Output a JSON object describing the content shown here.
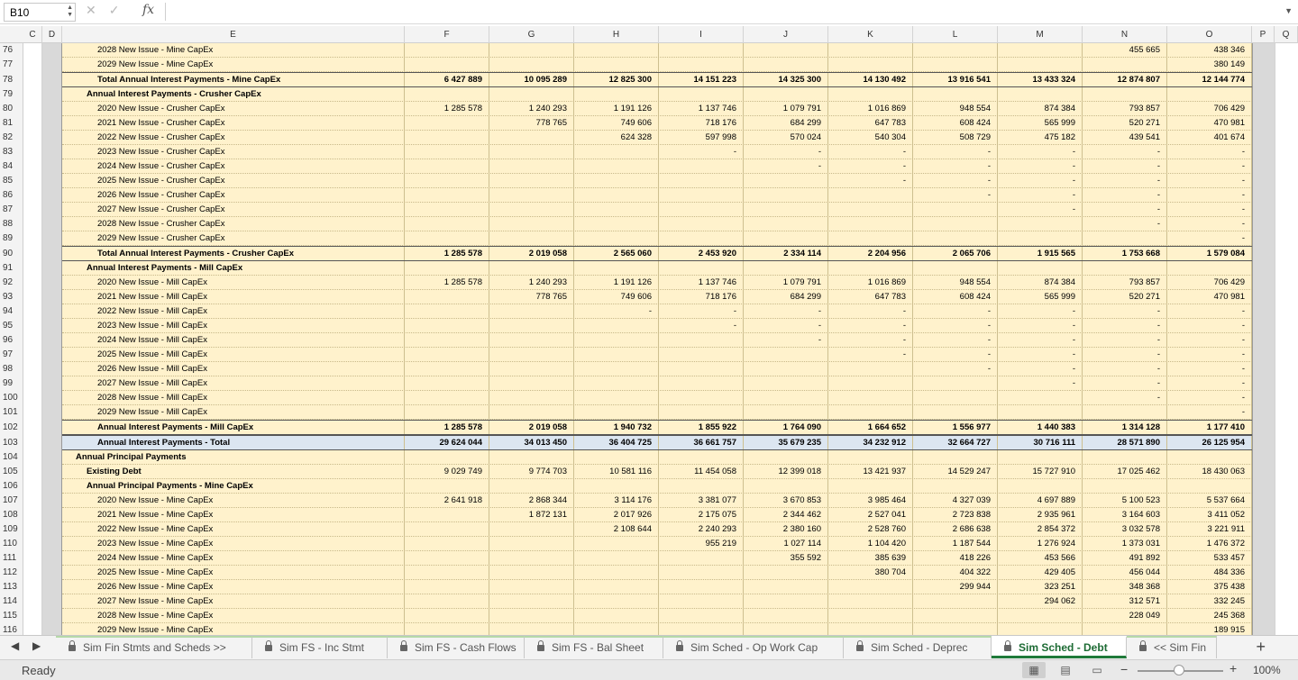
{
  "formula_bar": {
    "name_box": "B10",
    "fx_label": "fx"
  },
  "columns": {
    "narrow": [
      "C",
      "D"
    ],
    "wide": [
      "E",
      "F",
      "G",
      "H",
      "I",
      "J",
      "K",
      "L",
      "M",
      "N",
      "O"
    ],
    "right": [
      "P",
      "Q"
    ]
  },
  "rows": [
    {
      "n": "76",
      "label": "2028 New Issue - Mine CapEx",
      "lvl": 2,
      "type": "item",
      "v": [
        "",
        "",
        "",
        "",
        "",
        "",
        "",
        "",
        "455 665",
        "438 346"
      ]
    },
    {
      "n": "77",
      "label": "2029 New Issue - Mine CapEx",
      "lvl": 2,
      "type": "item",
      "v": [
        "",
        "",
        "",
        "",
        "",
        "",
        "",
        "",
        "",
        "380 149"
      ]
    },
    {
      "n": "78",
      "label": "Total Annual Interest Payments - Mine CapEx",
      "lvl": 2,
      "type": "total",
      "v": [
        "6 427 889",
        "10 095 289",
        "12 825 300",
        "14 151 223",
        "14 325 300",
        "14 130 492",
        "13 916 541",
        "13 433 324",
        "12 874 807",
        "12 144 774"
      ]
    },
    {
      "n": "79",
      "label": "Annual Interest Payments - Crusher CapEx",
      "lvl": 1,
      "type": "header",
      "v": [
        "",
        "",
        "",
        "",
        "",
        "",
        "",
        "",
        "",
        ""
      ]
    },
    {
      "n": "80",
      "label": "2020 New Issue - Crusher CapEx",
      "lvl": 2,
      "type": "item",
      "v": [
        "1 285 578",
        "1 240 293",
        "1 191 126",
        "1 137 746",
        "1 079 791",
        "1 016 869",
        "948 554",
        "874 384",
        "793 857",
        "706 429"
      ]
    },
    {
      "n": "81",
      "label": "2021 New Issue - Crusher CapEx",
      "lvl": 2,
      "type": "item",
      "v": [
        "",
        "778 765",
        "749 606",
        "718 176",
        "684 299",
        "647 783",
        "608 424",
        "565 999",
        "520 271",
        "470 981"
      ]
    },
    {
      "n": "82",
      "label": "2022 New Issue - Crusher CapEx",
      "lvl": 2,
      "type": "item",
      "v": [
        "",
        "",
        "624 328",
        "597 998",
        "570 024",
        "540 304",
        "508 729",
        "475 182",
        "439 541",
        "401 674"
      ]
    },
    {
      "n": "83",
      "label": "2023 New Issue - Crusher CapEx",
      "lvl": 2,
      "type": "item",
      "v": [
        "",
        "",
        "",
        "-",
        "-",
        "-",
        "-",
        "-",
        "-",
        "-"
      ]
    },
    {
      "n": "84",
      "label": "2024 New Issue - Crusher CapEx",
      "lvl": 2,
      "type": "item",
      "v": [
        "",
        "",
        "",
        "",
        "-",
        "-",
        "-",
        "-",
        "-",
        "-"
      ]
    },
    {
      "n": "85",
      "label": "2025 New Issue - Crusher CapEx",
      "lvl": 2,
      "type": "item",
      "v": [
        "",
        "",
        "",
        "",
        "",
        "-",
        "-",
        "-",
        "-",
        "-"
      ]
    },
    {
      "n": "86",
      "label": "2026 New Issue - Crusher CapEx",
      "lvl": 2,
      "type": "item",
      "v": [
        "",
        "",
        "",
        "",
        "",
        "",
        "-",
        "-",
        "-",
        "-"
      ]
    },
    {
      "n": "87",
      "label": "2027 New Issue - Crusher CapEx",
      "lvl": 2,
      "type": "item",
      "v": [
        "",
        "",
        "",
        "",
        "",
        "",
        "",
        "-",
        "-",
        "-"
      ]
    },
    {
      "n": "88",
      "label": "2028 New Issue - Crusher CapEx",
      "lvl": 2,
      "type": "item",
      "v": [
        "",
        "",
        "",
        "",
        "",
        "",
        "",
        "",
        "-",
        "-"
      ]
    },
    {
      "n": "89",
      "label": "2029 New Issue - Crusher CapEx",
      "lvl": 2,
      "type": "item",
      "v": [
        "",
        "",
        "",
        "",
        "",
        "",
        "",
        "",
        "",
        "-"
      ]
    },
    {
      "n": "90",
      "label": "Total Annual Interest Payments - Crusher CapEx",
      "lvl": 2,
      "type": "total",
      "v": [
        "1 285 578",
        "2 019 058",
        "2 565 060",
        "2 453 920",
        "2 334 114",
        "2 204 956",
        "2 065 706",
        "1 915 565",
        "1 753 668",
        "1 579 084"
      ]
    },
    {
      "n": "91",
      "label": "Annual Interest Payments - Mill CapEx",
      "lvl": 1,
      "type": "header",
      "v": [
        "",
        "",
        "",
        "",
        "",
        "",
        "",
        "",
        "",
        ""
      ]
    },
    {
      "n": "92",
      "label": "2020 New Issue - Mill CapEx",
      "lvl": 2,
      "type": "item",
      "v": [
        "1 285 578",
        "1 240 293",
        "1 191 126",
        "1 137 746",
        "1 079 791",
        "1 016 869",
        "948 554",
        "874 384",
        "793 857",
        "706 429"
      ]
    },
    {
      "n": "93",
      "label": "2021 New Issue - Mill CapEx",
      "lvl": 2,
      "type": "item",
      "v": [
        "",
        "778 765",
        "749 606",
        "718 176",
        "684 299",
        "647 783",
        "608 424",
        "565 999",
        "520 271",
        "470 981"
      ]
    },
    {
      "n": "94",
      "label": "2022 New Issue - Mill CapEx",
      "lvl": 2,
      "type": "item",
      "v": [
        "",
        "",
        "-",
        "-",
        "-",
        "-",
        "-",
        "-",
        "-",
        "-"
      ]
    },
    {
      "n": "95",
      "label": "2023 New Issue - Mill CapEx",
      "lvl": 2,
      "type": "item",
      "v": [
        "",
        "",
        "",
        "-",
        "-",
        "-",
        "-",
        "-",
        "-",
        "-"
      ]
    },
    {
      "n": "96",
      "label": "2024 New Issue - Mill CapEx",
      "lvl": 2,
      "type": "item",
      "v": [
        "",
        "",
        "",
        "",
        "-",
        "-",
        "-",
        "-",
        "-",
        "-"
      ]
    },
    {
      "n": "97",
      "label": "2025 New Issue - Mill CapEx",
      "lvl": 2,
      "type": "item",
      "v": [
        "",
        "",
        "",
        "",
        "",
        "-",
        "-",
        "-",
        "-",
        "-"
      ]
    },
    {
      "n": "98",
      "label": "2026 New Issue - Mill CapEx",
      "lvl": 2,
      "type": "item",
      "v": [
        "",
        "",
        "",
        "",
        "",
        "",
        "-",
        "-",
        "-",
        "-"
      ]
    },
    {
      "n": "99",
      "label": "2027 New Issue - Mill CapEx",
      "lvl": 2,
      "type": "item",
      "v": [
        "",
        "",
        "",
        "",
        "",
        "",
        "",
        "-",
        "-",
        "-"
      ]
    },
    {
      "n": "100",
      "label": "2028 New Issue - Mill CapEx",
      "lvl": 2,
      "type": "item",
      "v": [
        "",
        "",
        "",
        "",
        "",
        "",
        "",
        "",
        "-",
        "-"
      ]
    },
    {
      "n": "101",
      "label": "2029 New Issue - Mill CapEx",
      "lvl": 2,
      "type": "item",
      "v": [
        "",
        "",
        "",
        "",
        "",
        "",
        "",
        "",
        "",
        "-"
      ]
    },
    {
      "n": "102",
      "label": "Annual Interest Payments - Mill CapEx",
      "lvl": 2,
      "type": "total",
      "v": [
        "1 285 578",
        "2 019 058",
        "1 940 732",
        "1 855 922",
        "1 764 090",
        "1 664 652",
        "1 556 977",
        "1 440 383",
        "1 314 128",
        "1 177 410"
      ]
    },
    {
      "n": "103",
      "label": "Annual Interest Payments - Total",
      "lvl": 2,
      "type": "grand",
      "v": [
        "29 624 044",
        "34 013 450",
        "36 404 725",
        "36 661 757",
        "35 679 235",
        "34 232 912",
        "32 664 727",
        "30 716 111",
        "28 571 890",
        "26 125 954"
      ]
    },
    {
      "n": "104",
      "label": "Annual Principal Payments",
      "lvl": 0,
      "type": "header",
      "v": [
        "",
        "",
        "",
        "",
        "",
        "",
        "",
        "",
        "",
        ""
      ]
    },
    {
      "n": "105",
      "label": "Existing Debt",
      "lvl": 1,
      "type": "header",
      "v": [
        "9 029 749",
        "9 774 703",
        "10 581 116",
        "11 454 058",
        "12 399 018",
        "13 421 937",
        "14 529 247",
        "15 727 910",
        "17 025 462",
        "18 430 063"
      ]
    },
    {
      "n": "106",
      "label": "Annual Principal Payments - Mine CapEx",
      "lvl": 1,
      "type": "header",
      "v": [
        "",
        "",
        "",
        "",
        "",
        "",
        "",
        "",
        "",
        ""
      ]
    },
    {
      "n": "107",
      "label": "2020 New Issue - Mine CapEx",
      "lvl": 2,
      "type": "item",
      "v": [
        "2 641 918",
        "2 868 344",
        "3 114 176",
        "3 381 077",
        "3 670 853",
        "3 985 464",
        "4 327 039",
        "4 697 889",
        "5 100 523",
        "5 537 664"
      ]
    },
    {
      "n": "108",
      "label": "2021 New Issue - Mine CapEx",
      "lvl": 2,
      "type": "item",
      "v": [
        "",
        "1 872 131",
        "2 017 926",
        "2 175 075",
        "2 344 462",
        "2 527 041",
        "2 723 838",
        "2 935 961",
        "3 164 603",
        "3 411 052"
      ]
    },
    {
      "n": "109",
      "label": "2022 New Issue - Mine CapEx",
      "lvl": 2,
      "type": "item",
      "v": [
        "",
        "",
        "2 108 644",
        "2 240 293",
        "2 380 160",
        "2 528 760",
        "2 686 638",
        "2 854 372",
        "3 032 578",
        "3 221 911"
      ]
    },
    {
      "n": "110",
      "label": "2023 New Issue - Mine CapEx",
      "lvl": 2,
      "type": "item",
      "v": [
        "",
        "",
        "",
        "955 219",
        "1 027 114",
        "1 104 420",
        "1 187 544",
        "1 276 924",
        "1 373 031",
        "1 476 372"
      ]
    },
    {
      "n": "111",
      "label": "2024 New Issue - Mine CapEx",
      "lvl": 2,
      "type": "item",
      "v": [
        "",
        "",
        "",
        "",
        "355 592",
        "385 639",
        "418 226",
        "453 566",
        "491 892",
        "533 457"
      ]
    },
    {
      "n": "112",
      "label": "2025 New Issue - Mine CapEx",
      "lvl": 2,
      "type": "item",
      "v": [
        "",
        "",
        "",
        "",
        "",
        "380 704",
        "404 322",
        "429 405",
        "456 044",
        "484 336"
      ]
    },
    {
      "n": "113",
      "label": "2026 New Issue - Mine CapEx",
      "lvl": 2,
      "type": "item",
      "v": [
        "",
        "",
        "",
        "",
        "",
        "",
        "299 944",
        "323 251",
        "348 368",
        "375 438"
      ]
    },
    {
      "n": "114",
      "label": "2027 New Issue - Mine CapEx",
      "lvl": 2,
      "type": "item",
      "v": [
        "",
        "",
        "",
        "",
        "",
        "",
        "",
        "294 062",
        "312 571",
        "332 245"
      ]
    },
    {
      "n": "115",
      "label": "2028 New Issue - Mine CapEx",
      "lvl": 2,
      "type": "item",
      "v": [
        "",
        "",
        "",
        "",
        "",
        "",
        "",
        "",
        "228 049",
        "245 368"
      ]
    },
    {
      "n": "116",
      "label": "2029 New Issue - Mine CapEx",
      "lvl": 2,
      "type": "item",
      "v": [
        "",
        "",
        "",
        "",
        "",
        "",
        "",
        "",
        "",
        "189 915"
      ]
    }
  ],
  "sheet_tabs": [
    {
      "label": "Sim Fin Stmts and Scheds >>",
      "locked": true,
      "active": false
    },
    {
      "label": "Sim FS - Inc Stmt",
      "locked": true,
      "active": false
    },
    {
      "label": "Sim FS - Cash Flows",
      "locked": true,
      "active": false
    },
    {
      "label": "Sim FS - Bal Sheet",
      "locked": true,
      "active": false
    },
    {
      "label": "Sim Sched - Op Work Cap",
      "locked": true,
      "active": false
    },
    {
      "label": "Sim Sched - Deprec",
      "locked": true,
      "active": false
    },
    {
      "label": "Sim Sched - Debt",
      "locked": true,
      "active": true
    },
    {
      "label": "<< Sim Fin",
      "locked": true,
      "active": false
    }
  ],
  "status_bar": {
    "status": "Ready",
    "zoom": "100%"
  }
}
